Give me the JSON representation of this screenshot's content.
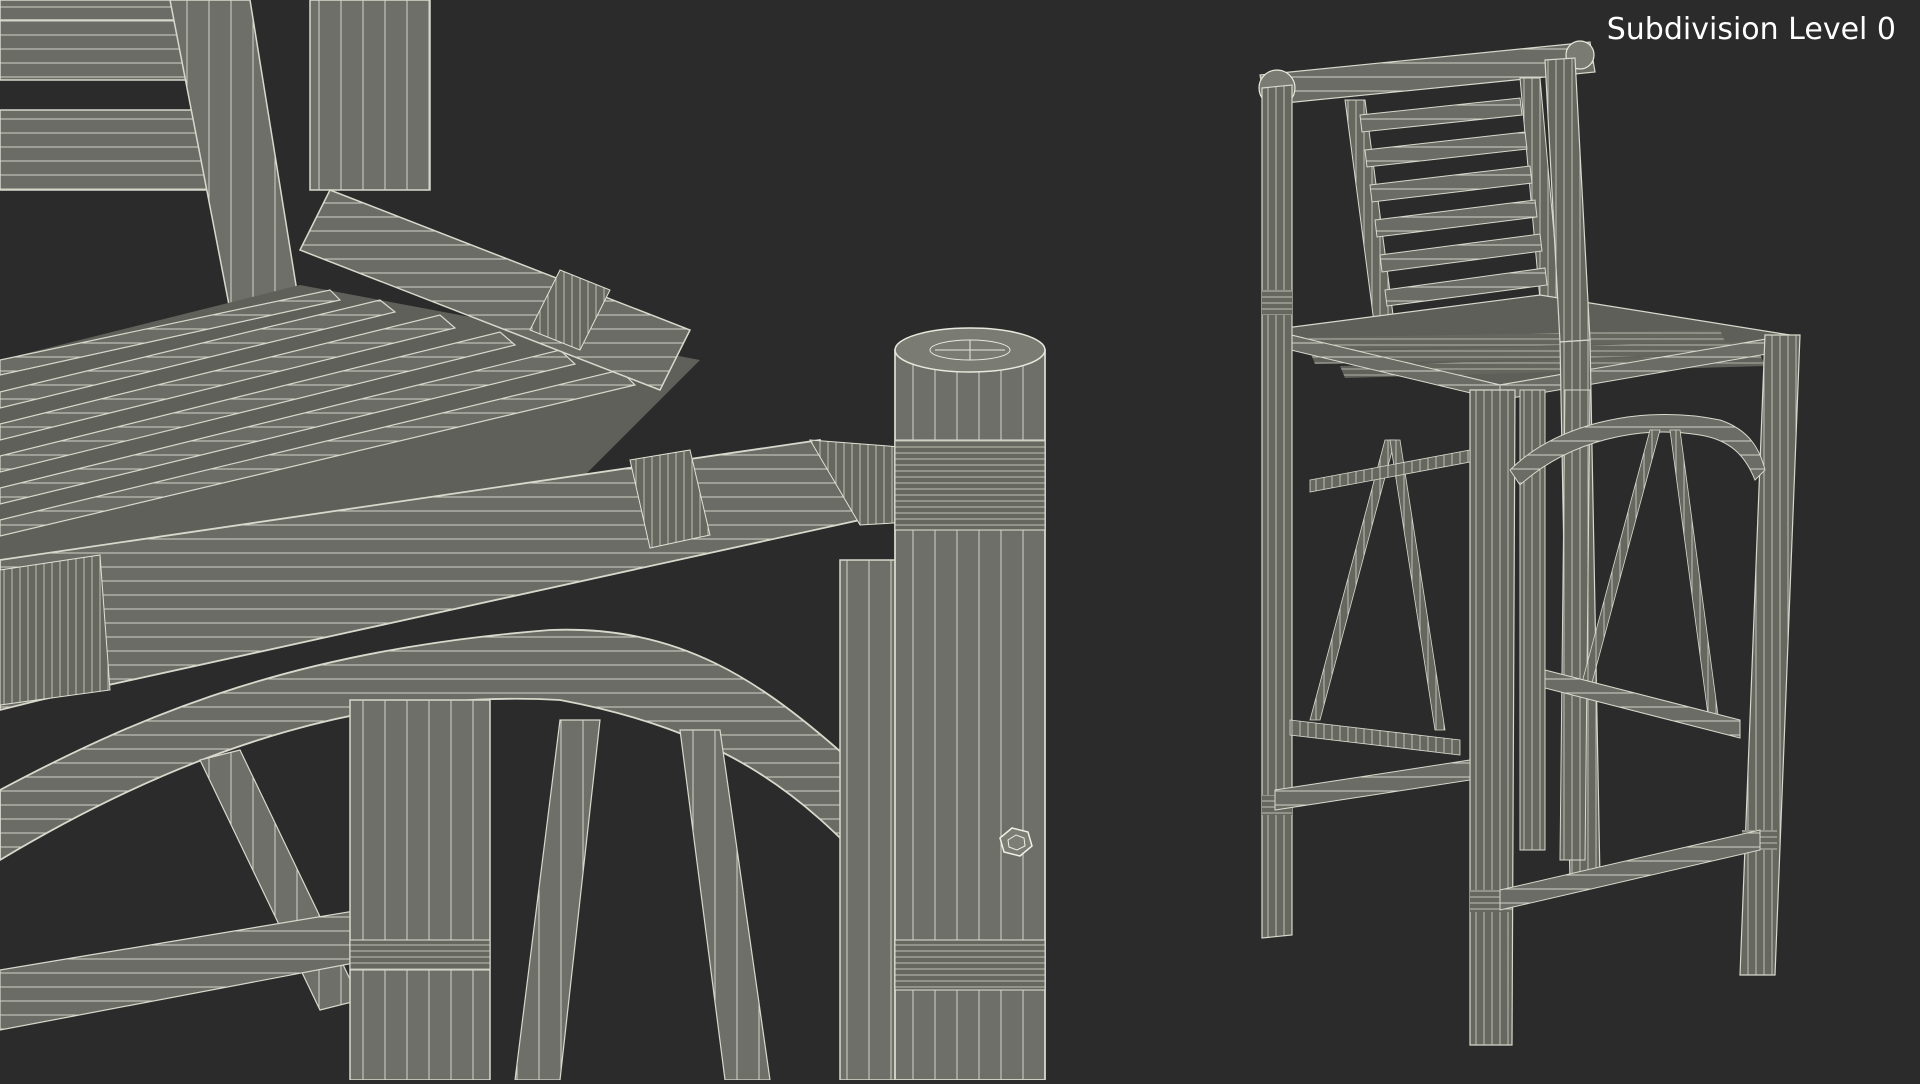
{
  "overlay": {
    "label": "Subdivision Level 0"
  },
  "colors": {
    "background": "#2b2b2b",
    "surface": "#6e6f68",
    "surface_dark": "#5a5b55",
    "surface_light": "#85867e",
    "wire": "#e8e8e0",
    "text": "#ffffff"
  }
}
